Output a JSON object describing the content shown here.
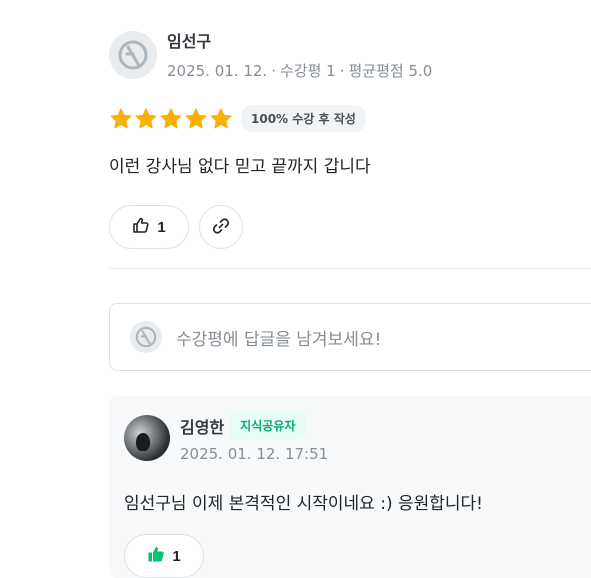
{
  "review": {
    "author": "임선구",
    "date": "2025. 01. 12.",
    "sep": "·",
    "course_count": "수강평 1",
    "avg_rating": "평균평점 5.0",
    "stars": 5,
    "badge": "100% 수강 후 작성",
    "text": "이런 강사님 없다 믿고 끝까지 갑니다",
    "like_count": "1"
  },
  "reply_input": {
    "placeholder": "수강평에 답글을 남겨보세요!"
  },
  "comment": {
    "author": "김영한",
    "badge": "지식공유자",
    "datetime": "2025. 01. 12. 17:51",
    "text": "임선구님 이제 본격적인 시작이네요 :) 응원합니다!",
    "like_count": "1"
  },
  "colors": {
    "star": "#fab005",
    "accent_green": "#00c471",
    "badge_green_text": "#0ca678"
  },
  "icons": {
    "avatar_default": "default-avatar-icon",
    "thumbs_up": "thumbs-up-icon",
    "link": "link-icon",
    "star": "star-icon"
  }
}
